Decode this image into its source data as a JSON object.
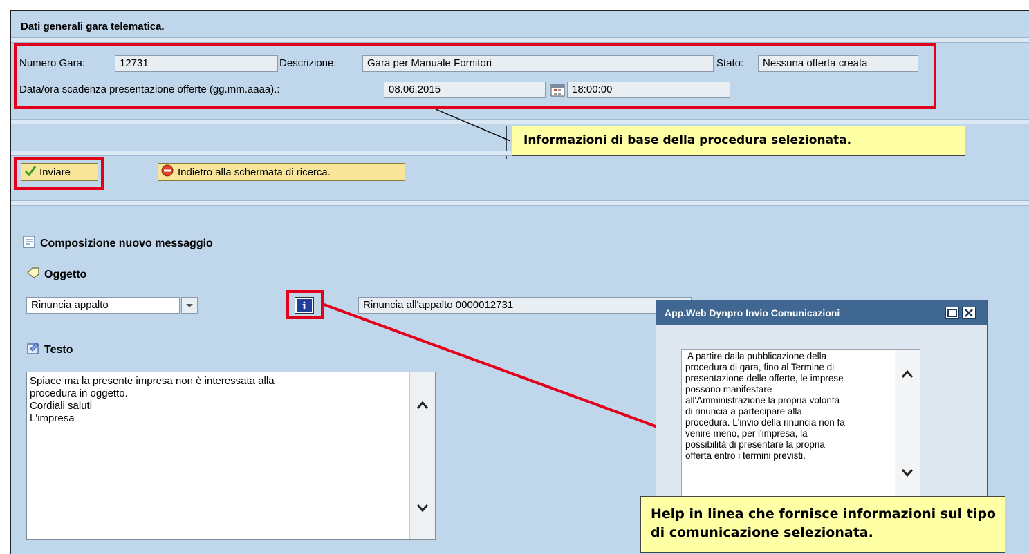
{
  "header": {
    "title": "Dati generali gara telematica."
  },
  "gara": {
    "numero_label": "Numero Gara:",
    "numero_value": "12731",
    "descrizione_label": "Descrizione:",
    "descrizione_value": "Gara per Manuale Fornitori",
    "stato_label": "Stato:",
    "stato_value": "Nessuna offerta creata",
    "scadenza_label": "Data/ora scadenza presentazione offerte (gg.mm.aaaa).:",
    "scadenza_date": "08.06.2015",
    "scadenza_time": "18:00:00"
  },
  "callouts": {
    "info_base": "Informazioni di base della procedura selezionata.",
    "help": "Help in linea che fornisce informazioni sul tipo di comunicazione selezionata."
  },
  "toolbar": {
    "send_label": "Inviare",
    "back_label": "Indietro alla schermata di ricerca."
  },
  "compose": {
    "title": "Composizione nuovo messaggio",
    "oggetto_label": "Oggetto",
    "oggetto_select": "Rinuncia appalto",
    "oggetto_text": "Rinuncia all'appalto 0000012731",
    "testo_label": "Testo",
    "testo_lines": [
      "Spiace ma la presente impresa non è interessata alla",
      "procedura in oggetto.",
      "Cordiali saluti",
      "L'impresa"
    ]
  },
  "popup": {
    "title": "App.Web Dynpro Invio Comunicazioni",
    "body_lines": [
      " A partire dalla pubblicazione della",
      "procedura di gara, fino al Termine di",
      "presentazione delle offerte, le imprese",
      "possono manifestare",
      "all'Amministrazione la propria volontà",
      "di rinuncia a partecipare alla",
      "procedura. L'invio della rinuncia non fa",
      "venire meno, per l'impresa, la",
      "possibilità di presentare la propria",
      "offerta entro i termini previsti."
    ]
  },
  "colors": {
    "background": "#c0d6ea",
    "highlight_red": "#e3001b",
    "callout_yellow": "#ffffa6",
    "button_yellow": "#f7e69a",
    "popup_title": "#3f6792"
  }
}
